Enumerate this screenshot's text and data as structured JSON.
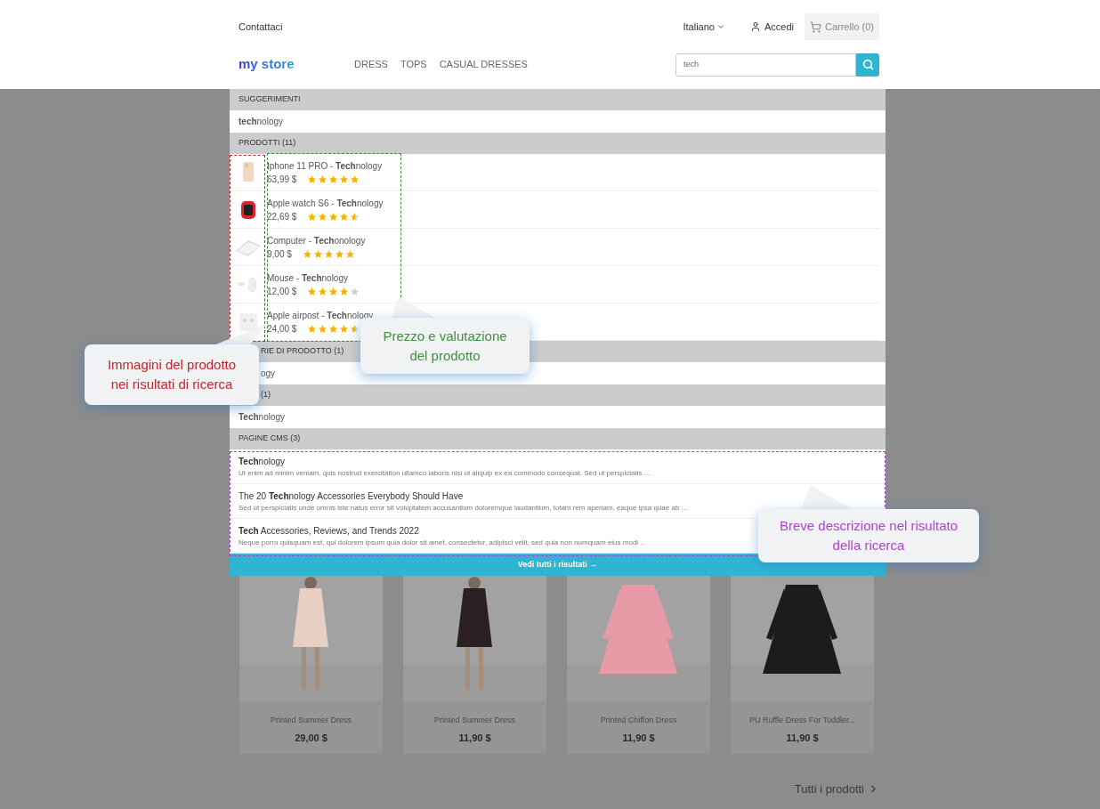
{
  "topbar": {
    "contact": "Contattaci",
    "language": "Italiano",
    "login": "Accedi",
    "cart": "Carrello (0)"
  },
  "header": {
    "logo": "my store",
    "menu": [
      "DRESS",
      "TOPS",
      "CASUAL DRESSES"
    ],
    "search": {
      "value": "tech"
    }
  },
  "dropdown": {
    "sections": [
      {
        "heading": "SUGGERIMENTI",
        "kind": "simple",
        "items": [
          {
            "text": "**tech**nology"
          }
        ]
      },
      {
        "heading": "PRODOTTI (11)",
        "kind": "products",
        "items": [
          {
            "name": "Iphone 11 PRO - **Tech**nology",
            "price": "63,99 $",
            "stars": 5
          },
          {
            "name": "Apple watch S6 - **Tech**nology",
            "price": "22,69 $",
            "stars": 4.5
          },
          {
            "name": "Computer - **Tech**onology",
            "price": "9,00 $",
            "stars": 5
          },
          {
            "name": "Mouse - **Tech**nology",
            "price": "12,00 $",
            "stars": 4
          },
          {
            "name": "Apple airpost - **Tech**nology",
            "price": "24,00 $",
            "stars": 4.5
          }
        ]
      },
      {
        "heading": "RIE DI PRODOTTO (1)",
        "heading_hidden_by_callout": true,
        "kind": "simple",
        "items": [
          {
            "text": "ogy",
            "hidden_by_callout": true
          }
        ]
      },
      {
        "heading": "(1)",
        "heading_hidden_by_callout": true,
        "kind": "simple",
        "items": [
          {
            "text": "**Tech**nology"
          }
        ]
      },
      {
        "heading": "PAGINE CMS (3)",
        "kind": "pages",
        "items": [
          {
            "title": "**Tech**nology",
            "description": "Ut enim ad minim veniam, quis nostrud exercitation ullamco laboris nisi ut aliquip ex ea commodo consequat. Sed ut perspiciatis ..."
          },
          {
            "title": "The 20 **Tech**nology Accessories Everybody Should Have",
            "description": "Sed ut perspiciatis unde omnis iste natus error sit voluptatem accusantium doloremque laudantium, totam rem aperiam, eaque ipsa quae ab ..."
          },
          {
            "title": "**Tech** Accessories, Reviews, and Trends 2022",
            "description": "Neque porro quisquam est, qui dolorem ipsum quia dolor sit amet, consectetur, adipisci velit, sed quia non numquam eius modi ..."
          }
        ]
      }
    ],
    "see_all": "Vedi tutti i risultati →"
  },
  "products": [
    {
      "name": "Printed Summer Dress",
      "price": "29,00 $",
      "color": "#e8cfc4"
    },
    {
      "name": "Printed Summer Dress",
      "price": "11,90 $",
      "color": "#2a1f22"
    },
    {
      "name": "Printed Chiffon Dress",
      "price": "11,90 $",
      "color": "#e59aa6"
    },
    {
      "name": "PU Ruffle Dress For Toddler...",
      "price": "11,90 $",
      "color": "#1c1c1c"
    }
  ],
  "all_products": "Tutti i prodotti",
  "callouts": [
    {
      "lines": [
        "Immagini del prodotto",
        "nei risultati di ricerca"
      ],
      "color": "#c3262e"
    },
    {
      "lines": [
        "Prezzo e valutazione",
        "del prodotto"
      ],
      "color": "#3f8f3f"
    },
    {
      "lines": [
        "Breve descrizione nel risultato",
        "della ricerca"
      ],
      "color": "#b13fd6"
    }
  ]
}
